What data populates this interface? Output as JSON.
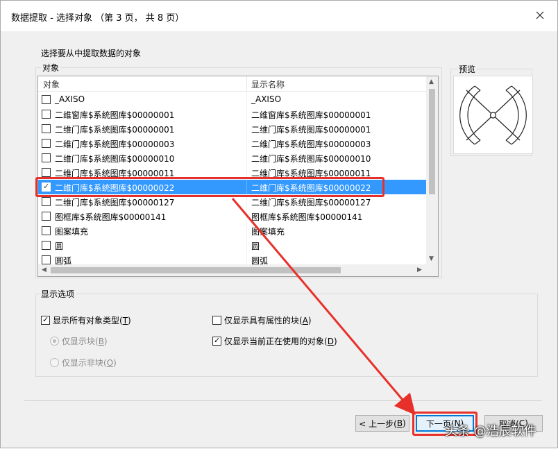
{
  "window": {
    "title": "数据提取 - 选择对象 （第 3 页， 共 8 页）"
  },
  "instruction": "选择要从中提取数据的对象",
  "objects_group": {
    "title": "对象",
    "columns": [
      "对象",
      "显示名称"
    ],
    "rows": [
      {
        "checked": false,
        "selected": false,
        "object": "_AXISO",
        "display_name": "_AXISO"
      },
      {
        "checked": false,
        "selected": false,
        "object": "二维窗库$系统图库$00000001",
        "display_name": "二维窗库$系统图库$00000001"
      },
      {
        "checked": false,
        "selected": false,
        "object": "二维门库$系统图库$00000001",
        "display_name": "二维门库$系统图库$00000001"
      },
      {
        "checked": false,
        "selected": false,
        "object": "二维门库$系统图库$00000003",
        "display_name": "二维门库$系统图库$00000003"
      },
      {
        "checked": false,
        "selected": false,
        "object": "二维门库$系统图库$00000010",
        "display_name": "二维门库$系统图库$00000010"
      },
      {
        "checked": false,
        "selected": false,
        "object": "二维门库$系统图库$00000011",
        "display_name": "二维门库$系统图库$00000011"
      },
      {
        "checked": true,
        "selected": true,
        "object": "二维门库$系统图库$00000022",
        "display_name": "二维门库$系统图库$00000022"
      },
      {
        "checked": false,
        "selected": false,
        "object": "二维门库$系统图库$00000127",
        "display_name": "二维门库$系统图库$00000127"
      },
      {
        "checked": false,
        "selected": false,
        "object": "图框库$系统图库$00000141",
        "display_name": "图框库$系统图库$00000141"
      },
      {
        "checked": false,
        "selected": false,
        "object": "图案填充",
        "display_name": "图案填充"
      },
      {
        "checked": false,
        "selected": false,
        "object": "圆",
        "display_name": "圆"
      },
      {
        "checked": false,
        "selected": false,
        "object": "圆弧",
        "display_name": "圆弧"
      }
    ]
  },
  "preview": {
    "title": "预览"
  },
  "display_options": {
    "title": "显示选项",
    "show_all_types": {
      "label": "显示所有对象类型(",
      "key": "T",
      "suffix": ")",
      "checked": true
    },
    "blocks_only": {
      "label": "仅显示块(",
      "key": "B",
      "suffix": ")",
      "selected": true,
      "enabled": false
    },
    "non_blocks_only": {
      "label": "仅显示非块(",
      "key": "O",
      "suffix": ")",
      "selected": false,
      "enabled": false
    },
    "attr_blocks_only": {
      "label": "仅显示具有属性的块(",
      "key": "A",
      "suffix": ")",
      "checked": false
    },
    "in_use_only": {
      "label": "仅显示当前正在使用的对象(",
      "key": "D",
      "suffix": ")",
      "checked": true
    }
  },
  "buttons": {
    "back": {
      "label": "< 上一步(",
      "key": "B",
      "suffix": ")"
    },
    "next": {
      "label": "下一页(",
      "key": "N",
      "suffix": ")"
    },
    "cancel": {
      "label": "取消(",
      "key": "C",
      "suffix": ")"
    }
  },
  "watermark": "头条 @浩辰软件",
  "colors": {
    "selection": "#3399ff",
    "highlight": "#e8302a",
    "primary_border": "#0078d7"
  },
  "icons": {
    "close": "close-icon",
    "check": "checkmark-icon",
    "scroll_up": "chevron-up-icon",
    "scroll_down": "chevron-down-icon",
    "scroll_left": "chevron-left-icon",
    "scroll_right": "chevron-right-icon"
  }
}
